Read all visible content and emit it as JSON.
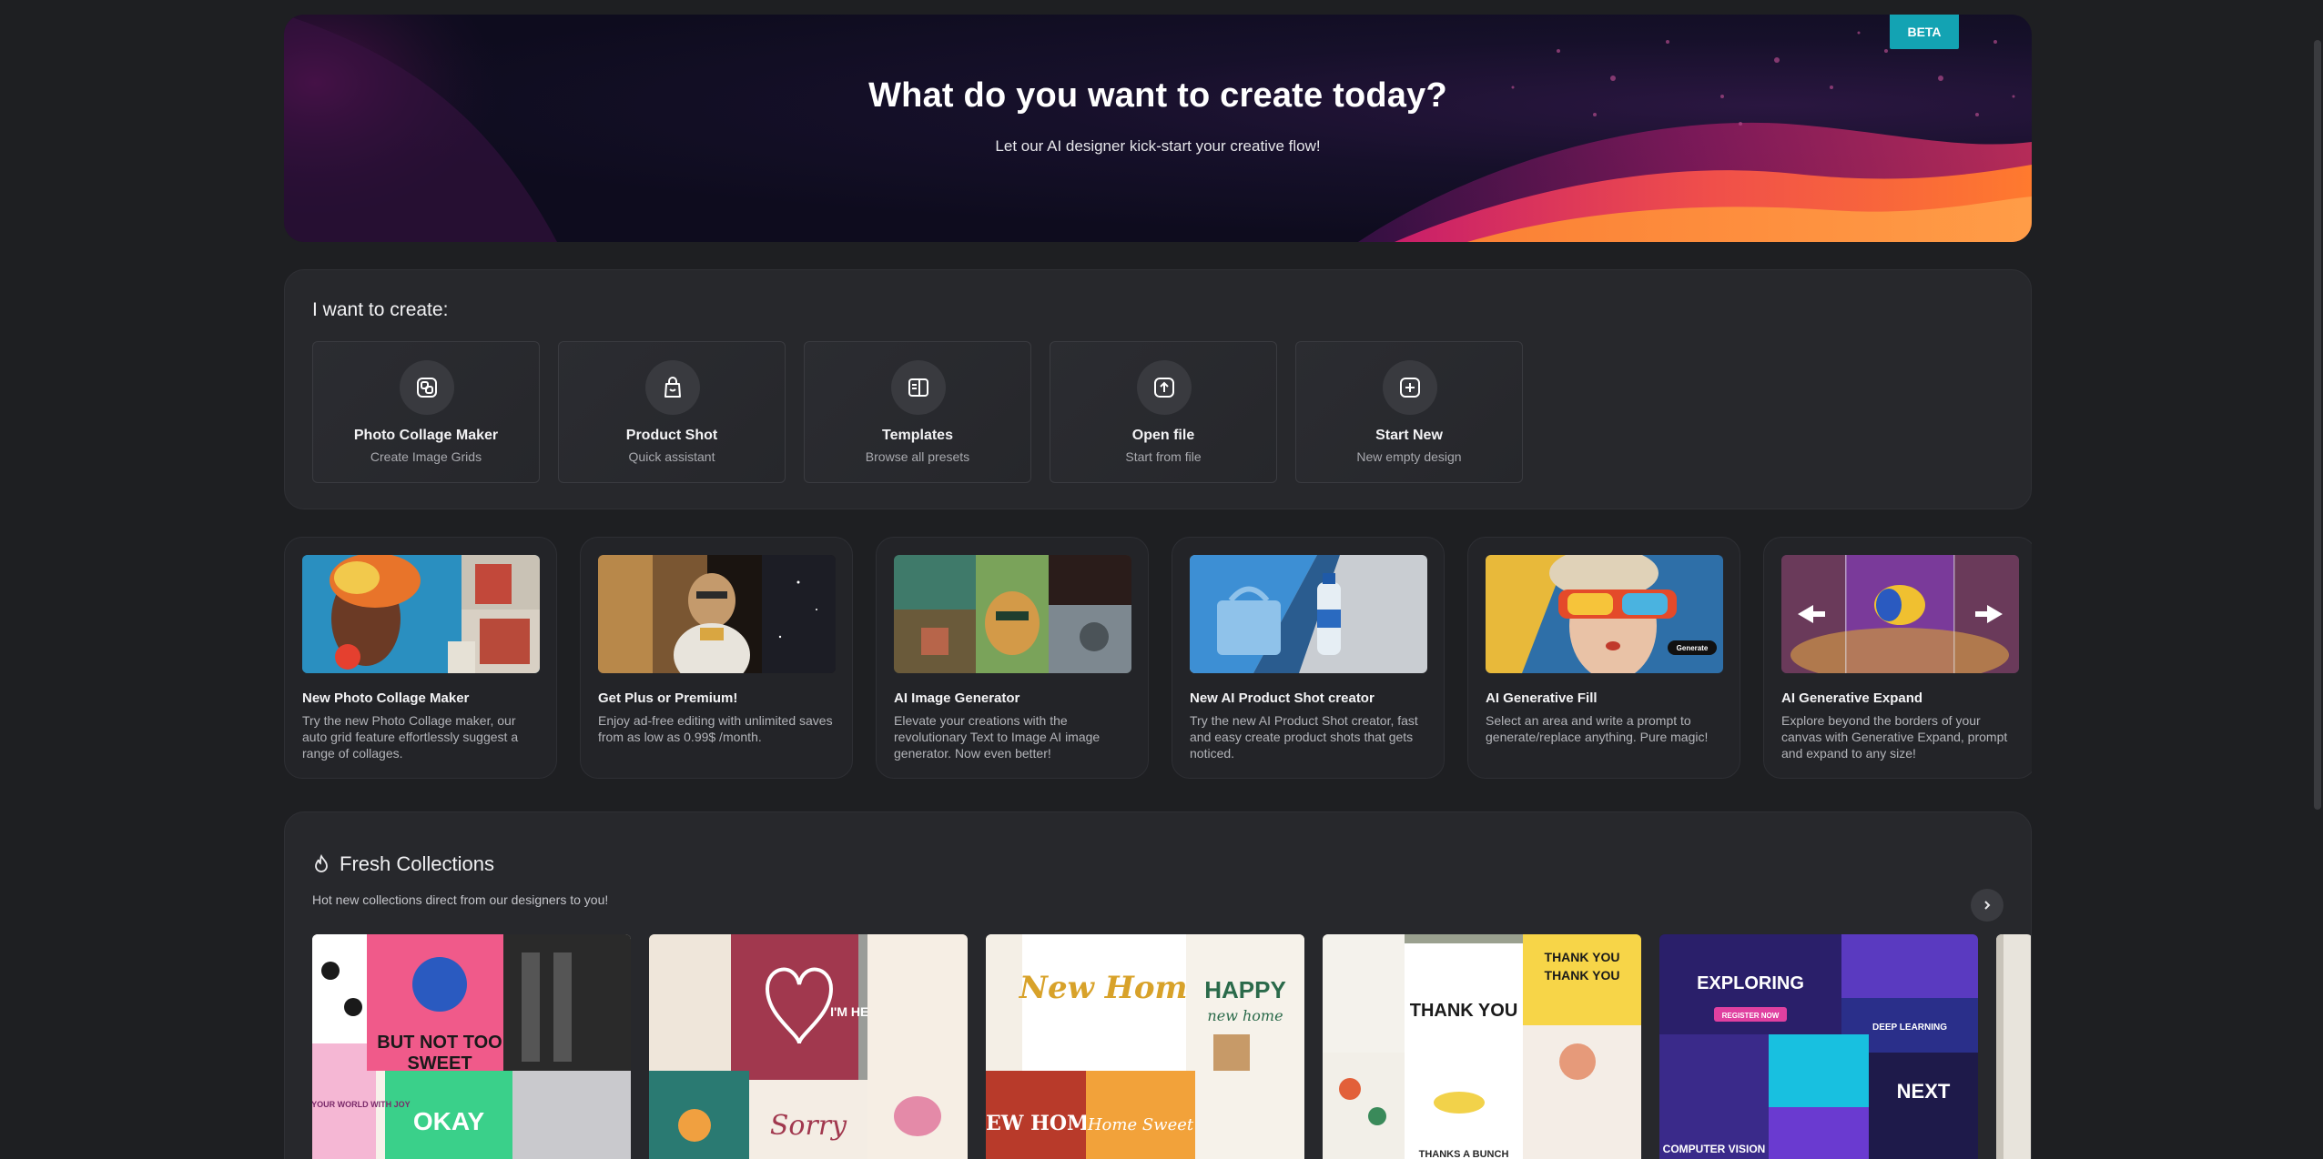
{
  "hero": {
    "title": "What do you want to create today?",
    "subtitle": "Let our AI designer kick-start your creative flow!",
    "badge": "BETA"
  },
  "create": {
    "heading": "I want to create:",
    "cards": [
      {
        "title": "Photo Collage Maker",
        "subtitle": "Create Image Grids",
        "icon": "collage-icon"
      },
      {
        "title": "Product Shot",
        "subtitle": "Quick assistant",
        "icon": "shopping-bag-icon"
      },
      {
        "title": "Templates",
        "subtitle": "Browse all presets",
        "icon": "templates-icon"
      },
      {
        "title": "Open file",
        "subtitle": "Start from file",
        "icon": "upload-icon"
      },
      {
        "title": "Start New",
        "subtitle": "New empty design",
        "icon": "plus-square-icon"
      }
    ]
  },
  "features": [
    {
      "title": "New Photo Collage Maker",
      "description": "Try the new Photo Collage maker, our auto grid feature effortlessly suggest a range of collages."
    },
    {
      "title": "Get Plus or Premium!",
      "description": "Enjoy ad-free editing with unlimited saves from as low as 0.99$ /month."
    },
    {
      "title": "AI Image Generator",
      "description": "Elevate your creations with the revolutionary Text to Image AI image generator. Now even better!"
    },
    {
      "title": "New AI Product Shot creator",
      "description": "Try the new AI Product Shot creator, fast and easy create product shots that gets noticed."
    },
    {
      "title": "AI Generative Fill",
      "description": "Select an area and write a prompt to generate/replace anything. Pure magic!",
      "thumb_button": "Generate"
    },
    {
      "title": "AI Generative Expand",
      "description": "Explore beyond the borders of your canvas with Generative Expand, prompt and expand to any size!"
    }
  ],
  "collections": {
    "title": "Fresh Collections",
    "subtitle": "Hot new collections direct from our designers to you!",
    "items": [
      {
        "name": "but-not-too-sweet",
        "texts": [
          "BUT NOT TOO",
          "SWEET",
          "OKAY",
          "COLOR YOUR WORLD WITH JOY"
        ]
      },
      {
        "name": "love-cards",
        "texts": [
          "Sorry",
          "I'M HERE"
        ]
      },
      {
        "name": "new-home",
        "texts": [
          "New Home",
          "HAPPY",
          "new home",
          "NEW HOME",
          "Home Sweet"
        ]
      },
      {
        "name": "thank-you",
        "texts": [
          "THANK YOU",
          "THANK YOU",
          "THANK YOU",
          "THANKS A BUNCH"
        ]
      },
      {
        "name": "tech-events",
        "texts": [
          "EXPLORING",
          "REGISTER NOW",
          "DEEP LEARNING",
          "NEXT",
          "COMPUTER VISION"
        ]
      }
    ]
  },
  "colors": {
    "page_bg": "#1e1f22",
    "panel_bg": "#27282c",
    "accent_badge": "#13a3b3"
  }
}
